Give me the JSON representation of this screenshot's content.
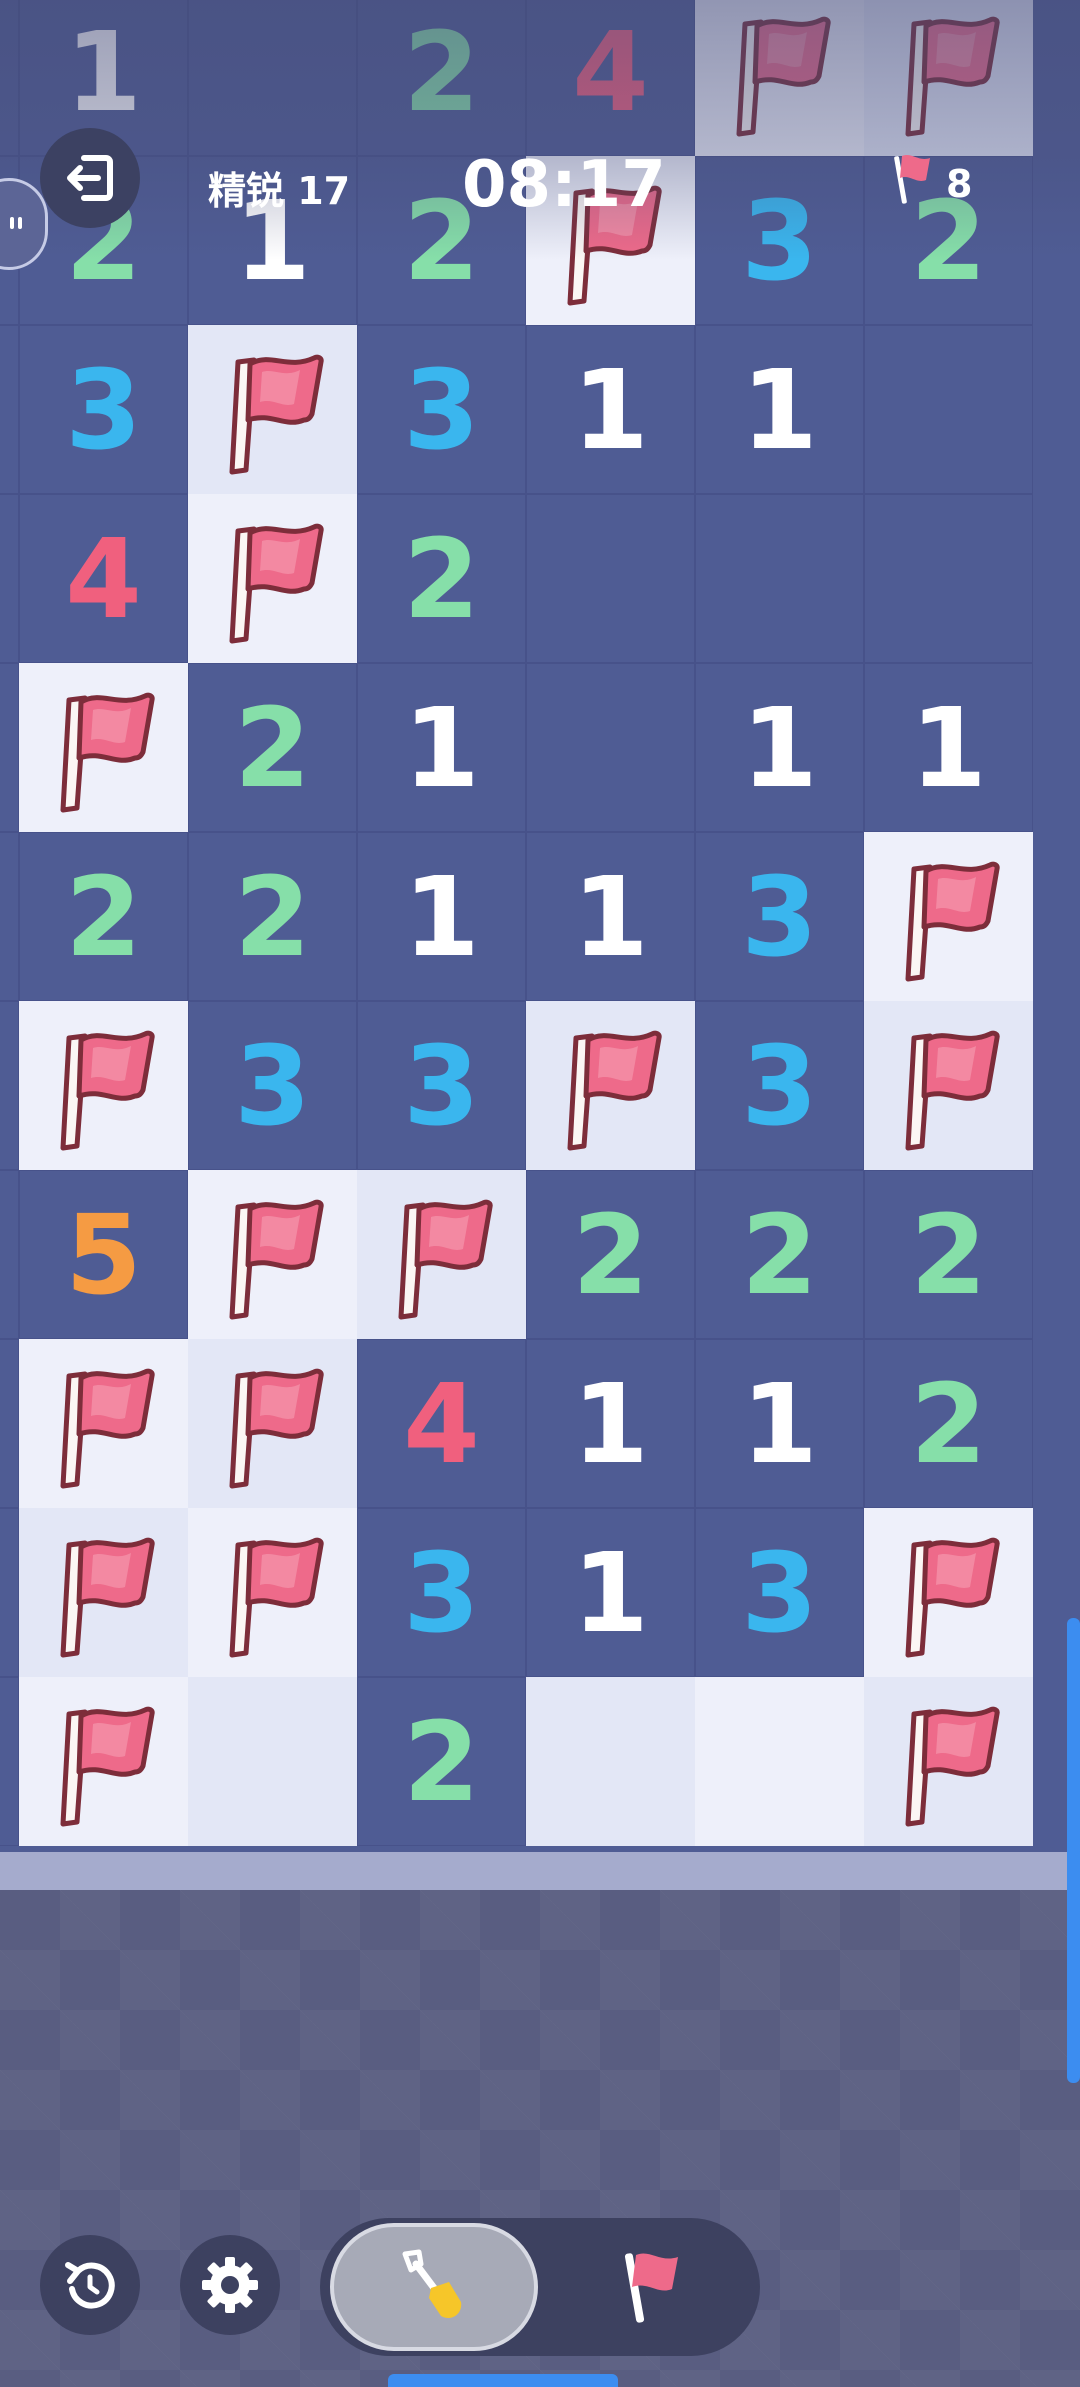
{
  "hud": {
    "level_label": "精锐 17",
    "timer": "08:17",
    "flags_remaining": "8"
  },
  "colors": {
    "1": "#ffffff",
    "2": "#86dfa9",
    "3": "#3ab6ee",
    "4": "#f0607e",
    "5": "#f59b43",
    "flag": "#ee6a8a",
    "accent": "#3c8df0"
  },
  "icons": {
    "exit": "exit-icon",
    "undo": "undo-icon",
    "settings": "gear-icon",
    "dig": "shovel-icon",
    "flag": "flag-icon",
    "chat": "chat-icon"
  },
  "board": {
    "columns": 7,
    "rows": [
      [
        "",
        "1",
        "",
        "2",
        "4",
        "F",
        "F"
      ],
      [
        "",
        "2",
        "1",
        "2",
        "F",
        "3",
        "2"
      ],
      [
        "",
        "3",
        "F",
        "3",
        "1",
        "1",
        ""
      ],
      [
        "",
        "4",
        "F",
        "2",
        "",
        "",
        ""
      ],
      [
        "",
        "F",
        "2",
        "1",
        "",
        "1",
        "1"
      ],
      [
        "",
        "2",
        "2",
        "1",
        "1",
        "3",
        "F"
      ],
      [
        "",
        "F",
        "3",
        "3",
        "F",
        "3",
        "F"
      ],
      [
        "",
        "5",
        "F",
        "F",
        "2",
        "2",
        "2"
      ],
      [
        "",
        "F",
        "F",
        "4",
        "1",
        "1",
        "2"
      ],
      [
        "",
        "F",
        "F",
        "3",
        "1",
        "3",
        "F"
      ],
      [
        "",
        "F",
        "R",
        "2",
        "R",
        "R",
        "F"
      ]
    ]
  }
}
